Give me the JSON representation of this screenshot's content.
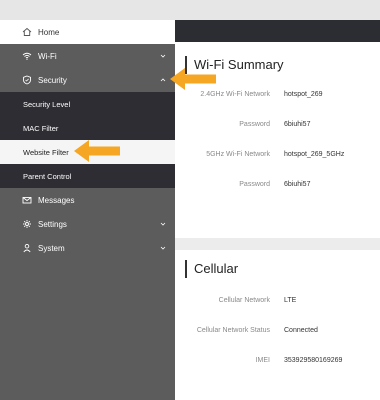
{
  "sidebar": {
    "items": [
      {
        "label": "Home",
        "icon": "home-icon"
      },
      {
        "label": "Wi-Fi",
        "icon": "wifi-icon"
      },
      {
        "label": "Security",
        "icon": "shield-icon"
      },
      {
        "label": "Messages",
        "icon": "envelope-icon"
      },
      {
        "label": "Settings",
        "icon": "gear-icon"
      },
      {
        "label": "System",
        "icon": "person-icon"
      }
    ],
    "security_subitems": [
      "Security Level",
      "MAC Filter",
      "Website Filter",
      "Parent Control"
    ]
  },
  "wifi_summary": {
    "title": "Wi-Fi Summary",
    "rows": [
      {
        "label": "2.4GHz Wi-Fi Network",
        "value": "hotspot_269"
      },
      {
        "label": "Password",
        "value": "6biuhi57"
      },
      {
        "label": "5GHz Wi-Fi Network",
        "value": "hotspot_269_5GHz"
      },
      {
        "label": "Password",
        "value": "6biuhi57"
      }
    ]
  },
  "cellular": {
    "title": "Cellular",
    "rows": [
      {
        "label": "Cellular Network",
        "value": "LTE"
      },
      {
        "label": "Cellular Network Status",
        "value": "Connected"
      },
      {
        "label": "IMEI",
        "value": "353929580169269"
      }
    ]
  },
  "colors": {
    "sidebar_bg": "#5c5c5c",
    "submenu_bg": "#2d2d33",
    "topbar_bg": "#2c2c33",
    "highlight_arrow": "#f5a623"
  }
}
